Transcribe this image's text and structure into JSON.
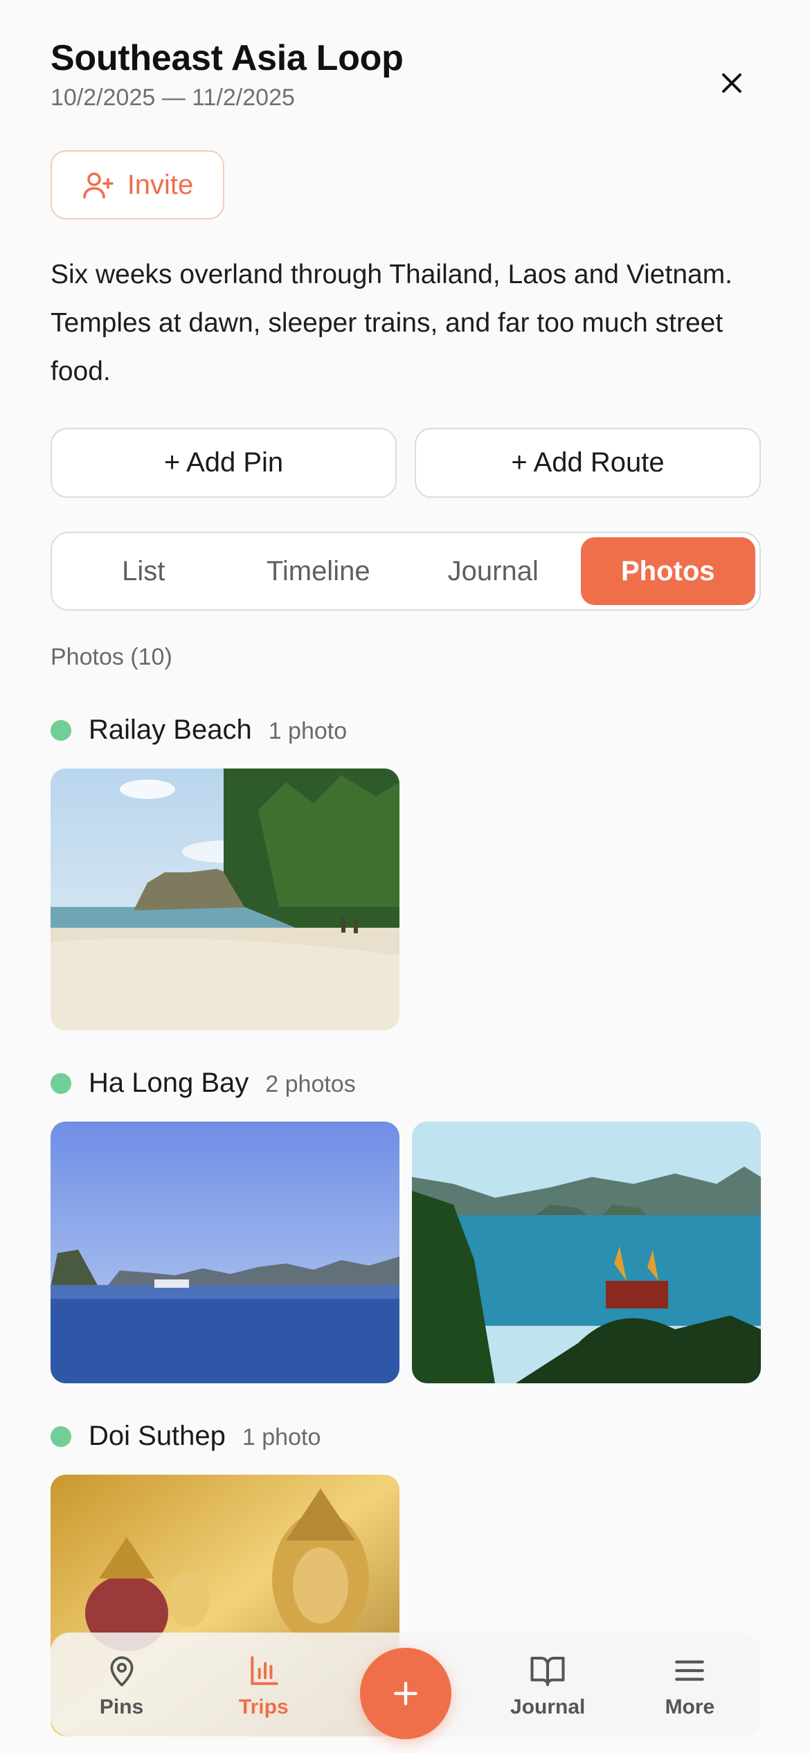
{
  "header": {
    "title": "Southeast Asia Loop",
    "dates": "10/2/2025 — 11/2/2025"
  },
  "icons": {
    "close": "close-icon",
    "invite": "user-plus-icon",
    "pins": "map-pin-icon",
    "trips": "bar-chart-icon",
    "add": "plus-icon",
    "journal": "book-open-icon",
    "more": "menu-icon"
  },
  "invite_label": "Invite",
  "description": "Six weeks overland through Thailand, Laos and Vietnam. Temples at dawn, sleeper trains, and far too much street food.",
  "actions": {
    "add_pin": "+ Add Pin",
    "add_route": "+ Add Route"
  },
  "tabs": [
    {
      "label": "List",
      "active": false
    },
    {
      "label": "Timeline",
      "active": false
    },
    {
      "label": "Journal",
      "active": false
    },
    {
      "label": "Photos",
      "active": true
    }
  ],
  "photos_label": "Photos (10)",
  "groups": [
    {
      "place": "Railay Beach",
      "count": "1 photo"
    },
    {
      "place": "Ha Long Bay",
      "count": "2 photos"
    },
    {
      "place": "Doi Suthep",
      "count": "1 photo"
    }
  ],
  "bottom_nav": {
    "pins": "Pins",
    "trips": "Trips",
    "journal": "Journal",
    "more": "More"
  },
  "colors": {
    "accent": "#ef6f4b",
    "pin_dot": "#6fcf97"
  }
}
